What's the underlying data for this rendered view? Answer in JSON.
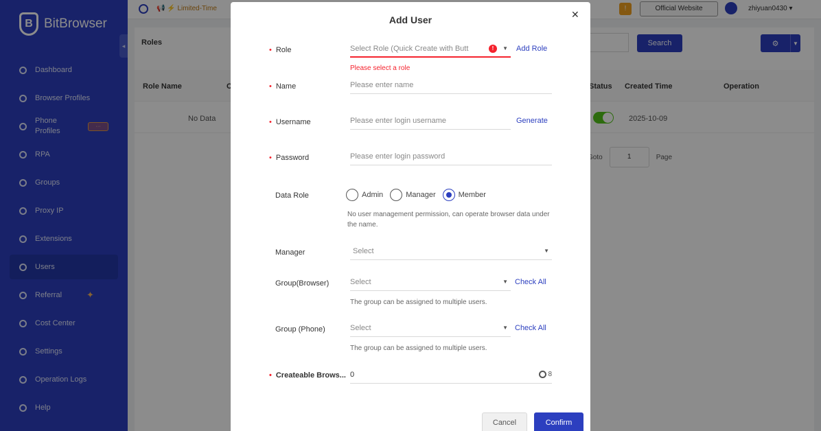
{
  "app": {
    "logo_text": "BitBrowser"
  },
  "sidebar": {
    "items": [
      {
        "label": "Dashboard"
      },
      {
        "label": "Browser Profiles"
      },
      {
        "label": "Phone Profiles"
      },
      {
        "label": "RPA"
      },
      {
        "label": "Groups"
      },
      {
        "label": "Proxy IP"
      },
      {
        "label": "Extensions"
      },
      {
        "label": "Users"
      },
      {
        "label": "Referral"
      },
      {
        "label": "Cost Center"
      },
      {
        "label": "Settings"
      },
      {
        "label": "Operation Logs"
      },
      {
        "label": "Help"
      }
    ]
  },
  "topbar": {
    "promo": "Limited-Time",
    "official_website": "Official Website",
    "username": "zhiyuan0430 ▾"
  },
  "page": {
    "title": "Roles",
    "search_label": "Search",
    "table": {
      "headers": [
        "Role Name",
        "C",
        "Status",
        "Created Time",
        "Operation"
      ],
      "row": {
        "name": "No Data",
        "created": "2025-10-09"
      }
    },
    "pager": {
      "goto": "Goto",
      "page_value": "1",
      "page": "Page"
    }
  },
  "modal": {
    "title": "Add User",
    "role": {
      "label": "Role",
      "placeholder": "Select Role (Quick Create with Butt",
      "error": "Please select a role",
      "add_role": "Add Role"
    },
    "name": {
      "label": "Name",
      "placeholder": "Please enter name"
    },
    "username": {
      "label": "Username",
      "placeholder": "Please enter login username",
      "generate": "Generate"
    },
    "password": {
      "label": "Password",
      "placeholder": "Please enter login password"
    },
    "data_role": {
      "label": "Data Role",
      "options": [
        "Admin",
        "Manager",
        "Member"
      ],
      "selected": "Member",
      "hint": "No user management permission, can operate browser data under the name."
    },
    "manager": {
      "label": "Manager",
      "placeholder": "Select"
    },
    "group_browser": {
      "label": "Group(Browser)",
      "placeholder": "Select",
      "check_all": "Check All",
      "hint": "The group can be assigned to multiple users."
    },
    "group_phone": {
      "label": "Group (Phone)",
      "placeholder": "Select",
      "check_all": "Check All",
      "hint": "The group can be assigned to multiple users."
    },
    "createable": {
      "label": "Createable Brows...",
      "value": "0",
      "max": "8"
    },
    "cancel": "Cancel",
    "confirm": "Confirm"
  },
  "colors": {
    "brand": "#2c3fbf",
    "error": "#f5222d",
    "success": "#52c41a"
  }
}
